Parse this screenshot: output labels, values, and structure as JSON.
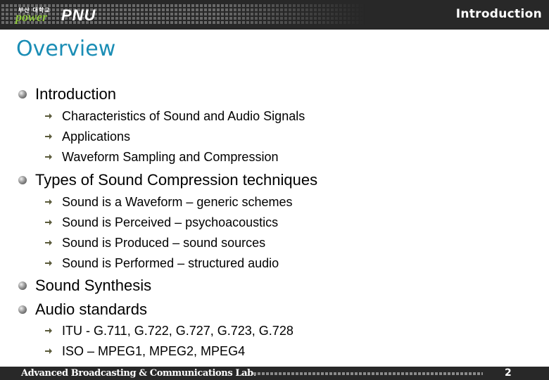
{
  "header": {
    "logo_small_text": "부산 대학교",
    "logo_power": "power",
    "logo_pnu": "PNU",
    "section_title": "Introduction"
  },
  "page_title": "Overview",
  "outline": [
    {
      "label": "Introduction",
      "children": [
        "Characteristics of Sound and Audio Signals",
        "Applications",
        "Waveform Sampling and Compression"
      ]
    },
    {
      "label": "Types of Sound Compression techniques",
      "children": [
        "Sound is a Waveform – generic schemes",
        "Sound is Perceived – psychoacoustics",
        "Sound is Produced – sound sources",
        "Sound is Performed – structured audio"
      ]
    },
    {
      "label": "Sound Synthesis",
      "children": []
    },
    {
      "label": "Audio standards",
      "children": [
        "ITU - G.711, G.722, G.727, G.723, G.728",
        "ISO – MPEG1, MPEG2, MPEG4"
      ]
    }
  ],
  "footer": {
    "lab_name": "Advanced Broadcasting & Communications Lab.",
    "page_number": "2"
  },
  "colors": {
    "title_accent": "#1a8db5",
    "header_bg": "#282828",
    "logo_green": "#8ec63f"
  }
}
